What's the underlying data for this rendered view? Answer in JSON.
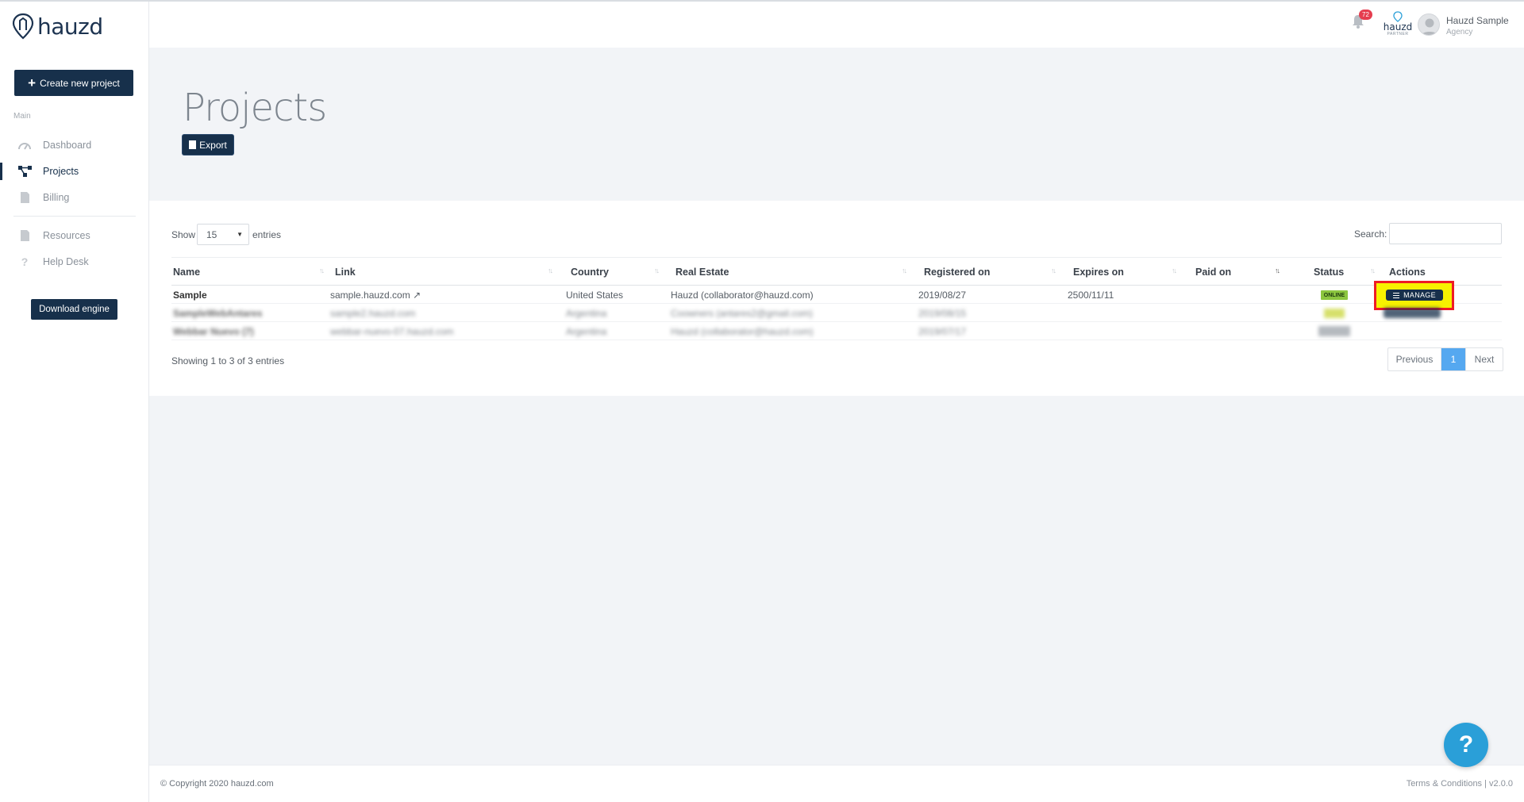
{
  "app": {
    "logo_text": "hauzd",
    "create_button": "Create new project",
    "download_button": "Download engine"
  },
  "sidebar": {
    "section_label": "Main",
    "items": [
      {
        "label": "Dashboard",
        "icon": "dashboard-icon",
        "active": false
      },
      {
        "label": "Projects",
        "icon": "projects-icon",
        "active": true
      },
      {
        "label": "Billing",
        "icon": "billing-icon",
        "active": false
      },
      {
        "label": "Resources",
        "icon": "resources-icon",
        "active": false
      },
      {
        "label": "Help Desk",
        "icon": "question-icon",
        "active": false
      }
    ]
  },
  "topbar": {
    "notification_count": "72",
    "partner_name": "hauzd",
    "partner_sub": "PARTNER",
    "user_name": "Hauzd Sample",
    "user_role": "Agency"
  },
  "page": {
    "title": "Projects",
    "export_button": "Export"
  },
  "table_controls": {
    "show_label": "Show",
    "show_value": "15",
    "entries_label": "entries",
    "search_label": "Search:",
    "search_value": ""
  },
  "table": {
    "columns": [
      "Name",
      "Link",
      "Country",
      "Real Estate",
      "Registered on",
      "Expires on",
      "Paid on",
      "Status",
      "Actions"
    ],
    "rows": [
      {
        "name": "Sample",
        "link": "sample.hauzd.com",
        "country": "United States",
        "real_estate": "Hauzd (collaborator@hauzd.com)",
        "registered_on": "2019/08/27",
        "expires_on": "2500/11/11",
        "paid_on": "",
        "status": "ONLINE",
        "action": "MANAGE"
      },
      {
        "name": "SampleWebAntares",
        "link": "sample2.hauzd.com",
        "country": "Argentina",
        "real_estate": "Coowners (antares2@gmail.com)",
        "registered_on": "2019/08/15",
        "expires_on": "",
        "paid_on": "",
        "status": "",
        "action": ""
      },
      {
        "name": "Webbar Nuevo (7)",
        "link": "webbar-nuevo-07.hauzd.com",
        "country": "Argentina",
        "real_estate": "Hauzd (collaborator@hauzd.com)",
        "registered_on": "2019/07/17",
        "expires_on": "",
        "paid_on": "",
        "status": "",
        "action": ""
      }
    ]
  },
  "footer_info": {
    "showing": "Showing 1 to 3 of 3 entries",
    "previous": "Previous",
    "current_page": "1",
    "next": "Next",
    "copyright": "© Copyright 2020 hauzd.com",
    "terms": "Terms & Conditions | v2.0.0"
  },
  "help_fab": "?",
  "colors": {
    "brand_navy": "#17304b",
    "online_green": "#8cc63f",
    "page_blue": "#55a8f0",
    "highlight_yellow": "#f7f200",
    "highlight_red": "#ee1c25",
    "fab_blue": "#2a9fd8"
  }
}
